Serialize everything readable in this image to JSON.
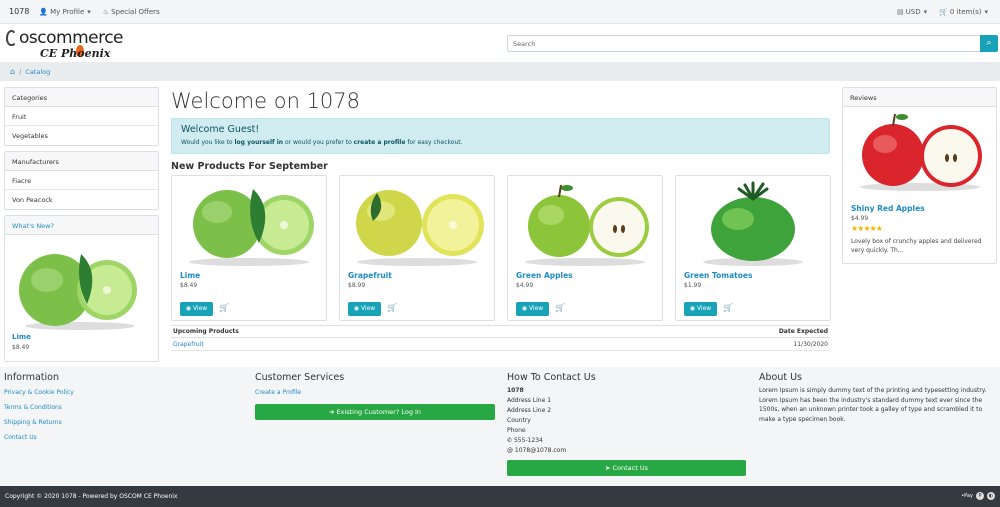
{
  "topbar": {
    "brand": "1078",
    "profile": "My Profile",
    "offers": "Special Offers",
    "currency": "USD",
    "cart": "0 item(s)"
  },
  "logo": {
    "line1": "oscommerce",
    "line2": "CE Phoenix"
  },
  "search": {
    "placeholder": "Search"
  },
  "breadcrumb": {
    "item": "Catalog"
  },
  "sidebar": {
    "categories": {
      "title": "Categories",
      "items": [
        "Fruit",
        "Vegetables"
      ]
    },
    "manufacturers": {
      "title": "Manufacturers",
      "items": [
        "Fiacre",
        "Von Peacock"
      ]
    },
    "whats_new": {
      "title": "What's New?",
      "name": "Lime",
      "price": "$8.49"
    }
  },
  "main": {
    "title": "Welcome on 1078",
    "alert": {
      "heading": "Welcome Guest!",
      "pre": "Would you like to ",
      "login": "log yourself in",
      "mid": " or would you prefer to ",
      "create": "create a profile",
      "post": " for easy checkout."
    },
    "new_products_title": "New Products For September",
    "products": [
      {
        "name": "Lime",
        "price": "$8.49",
        "view": "View"
      },
      {
        "name": "Grapefruit",
        "price": "$8.99",
        "view": "View"
      },
      {
        "name": "Green Apples",
        "price": "$4.99",
        "view": "View"
      },
      {
        "name": "Green Tomatoes",
        "price": "$1.99",
        "view": "View"
      }
    ],
    "upcoming": {
      "col1": "Upcoming Products",
      "col2": "Date Expected",
      "rows": [
        {
          "name": "Grapefruit",
          "date": "11/30/2020"
        }
      ]
    }
  },
  "reviews": {
    "title": "Reviews",
    "name": "Shiny Red Apples",
    "price": "$4.99",
    "stars": 5,
    "text": "Lovely box of crunchy apples and delivered very quickly. Th..."
  },
  "footer": {
    "information": {
      "title": "Information",
      "links": [
        "Privacy & Cookie Policy",
        "Terms & Conditions",
        "Shipping & Returns",
        "Contact Us"
      ]
    },
    "customer_services": {
      "title": "Customer Services",
      "link": "Create a Profile",
      "button": "Existing Customer? Log In"
    },
    "contact": {
      "title": "How To Contact Us",
      "name": "1078",
      "lines": [
        "Address Line 1",
        "Address Line 2",
        "Country",
        "Phone"
      ],
      "phone": "555-1234",
      "email": "1078@1078.com",
      "button": "Contact Us"
    },
    "about": {
      "title": "About Us",
      "text": "Lorem Ipsum is simply dummy text of the printing and typesetting industry. Lorem Ipsum has been the industry's standard dummy text ever since the 1500s, when an unknown printer took a galley of type and scrambled it to make a type specimen book."
    }
  },
  "copyright": "Copyright © 2020 1078 - Powered by OSCOM CE Phoenix",
  "pay": "•Pay",
  "colors": {
    "info": "#17a2b8",
    "success": "#28a745",
    "link": "#1e8bc3",
    "dark": "#343a40"
  }
}
